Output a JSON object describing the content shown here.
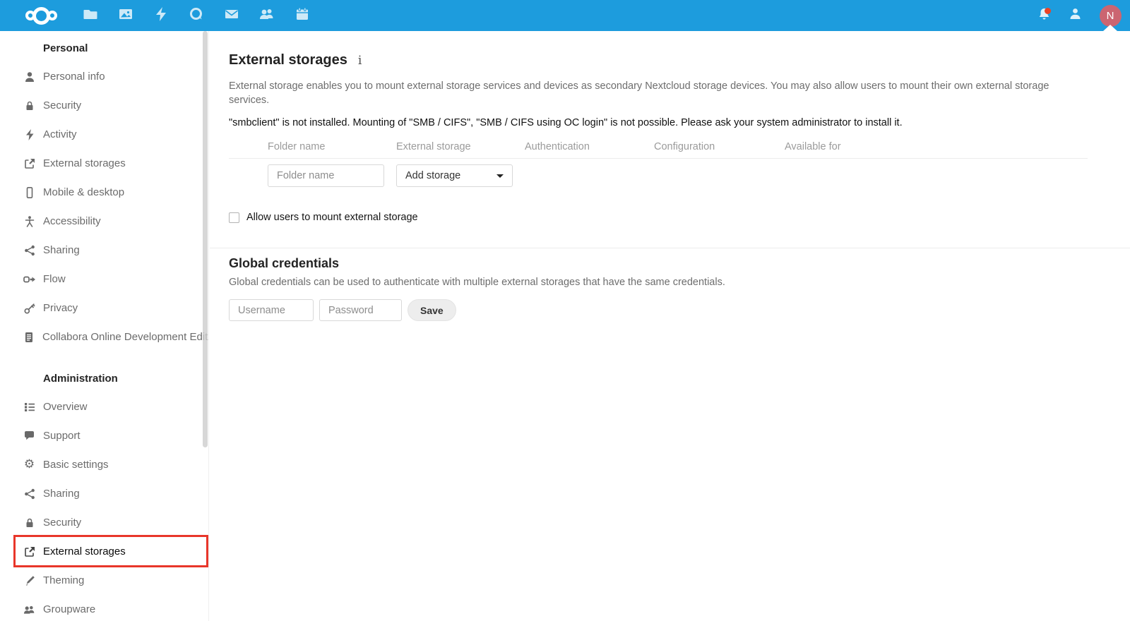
{
  "colors": {
    "header_bg": "#1d9cdd",
    "avatar_bg": "#cb6571",
    "notification_dot": "#eb4327",
    "annotation_red": "#e8362a"
  },
  "header": {
    "app_icons": [
      "nextcloud-logo",
      "files",
      "photos",
      "activity",
      "talk",
      "mail",
      "contacts",
      "calendar"
    ],
    "right_icons": [
      "notifications",
      "contacts-menu"
    ],
    "avatar_initial": "N"
  },
  "sidebar": {
    "sections": [
      {
        "caption": "Personal",
        "items": [
          {
            "label": "Personal info",
            "icon": "user-icon"
          },
          {
            "label": "Security",
            "icon": "lock-icon"
          },
          {
            "label": "Activity",
            "icon": "bolt-icon"
          },
          {
            "label": "External storages",
            "icon": "external-link-icon"
          },
          {
            "label": "Mobile & desktop",
            "icon": "phone-icon"
          },
          {
            "label": "Accessibility",
            "icon": "accessibility-icon"
          },
          {
            "label": "Sharing",
            "icon": "share-icon"
          },
          {
            "label": "Flow",
            "icon": "flow-icon"
          },
          {
            "label": "Privacy",
            "icon": "key-icon"
          },
          {
            "label": "Collabora Online Development Edit...",
            "icon": "document-icon"
          }
        ]
      },
      {
        "caption": "Administration",
        "items": [
          {
            "label": "Overview",
            "icon": "list-icon"
          },
          {
            "label": "Support",
            "icon": "chat-icon"
          },
          {
            "label": "Basic settings",
            "icon": "gear-icon"
          },
          {
            "label": "Sharing",
            "icon": "share-icon"
          },
          {
            "label": "Security",
            "icon": "lock-icon"
          },
          {
            "label": "External storages",
            "icon": "external-link-icon",
            "active": true,
            "annotated": true
          },
          {
            "label": "Theming",
            "icon": "brush-icon"
          },
          {
            "label": "Groupware",
            "icon": "group-icon"
          }
        ]
      }
    ]
  },
  "main": {
    "title": "External storages",
    "info_icon": "i",
    "description": "External storage enables you to mount external storage services and devices as secondary Nextcloud storage devices. You may also allow users to mount their own external storage services.",
    "warning": "\"smbclient\" is not installed. Mounting of \"SMB / CIFS\", \"SMB / CIFS using OC login\" is not possible. Please ask your system administrator to install it.",
    "table": {
      "headers": [
        "Folder name",
        "External storage",
        "Authentication",
        "Configuration",
        "Available for"
      ]
    },
    "form": {
      "folder_name_placeholder": "Folder name",
      "add_storage_label": "Add storage"
    },
    "allow_checkbox_label": "Allow users to mount external storage",
    "global_credentials": {
      "title": "Global credentials",
      "description": "Global credentials can be used to authenticate with multiple external storages that have the same credentials.",
      "username_placeholder": "Username",
      "password_placeholder": "Password",
      "save_label": "Save"
    }
  }
}
